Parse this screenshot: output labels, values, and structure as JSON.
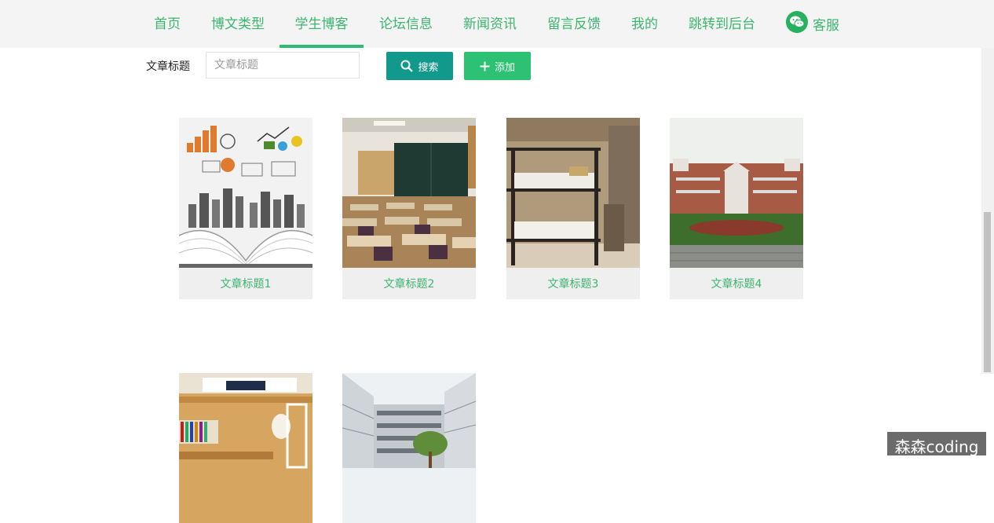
{
  "nav": {
    "items": [
      {
        "label": "首页"
      },
      {
        "label": "博文类型"
      },
      {
        "label": "学生博客"
      },
      {
        "label": "论坛信息"
      },
      {
        "label": "新闻资讯"
      },
      {
        "label": "留言反馈"
      },
      {
        "label": "我的"
      },
      {
        "label": "跳转到后台"
      }
    ],
    "active_index": 2,
    "service_label": "客服",
    "service_icon": "wechat-icon"
  },
  "search": {
    "label": "文章标题",
    "placeholder": "文章标题",
    "value": "",
    "search_button": "搜索",
    "add_button": "添加"
  },
  "cards": [
    {
      "title": "文章标题1",
      "image": "open-book-business-icons"
    },
    {
      "title": "文章标题2",
      "image": "classroom-desks-blackboard"
    },
    {
      "title": "文章标题3",
      "image": "dormitory-bunk-beds"
    },
    {
      "title": "文章标题4",
      "image": "campus-building-garden"
    },
    {
      "title": "",
      "image": "dorm-loft-bed-bookshelf"
    },
    {
      "title": "",
      "image": "modern-campus-building"
    }
  ],
  "watermark": "森森coding",
  "colors": {
    "accent": "#3cb56f",
    "search_button": "#11998c",
    "add_button": "#2dc273",
    "nav_bg": "#f4f4f4"
  }
}
